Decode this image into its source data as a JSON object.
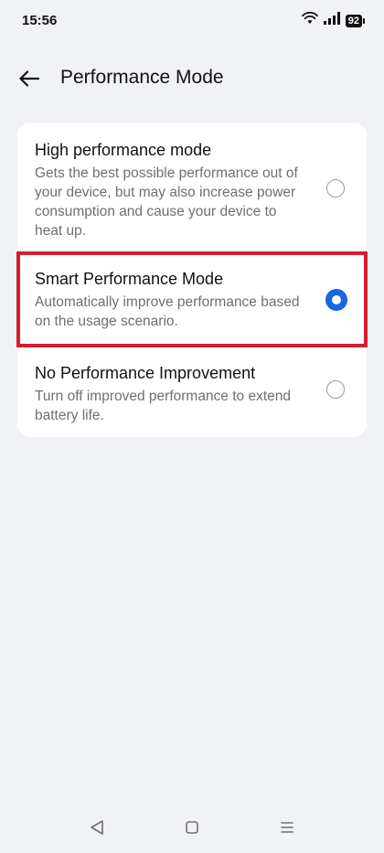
{
  "status_bar": {
    "time": "15:56",
    "battery_level": "92",
    "icons": [
      "wifi-icon",
      "signal-icon",
      "battery-icon"
    ]
  },
  "header": {
    "title": "Performance Mode",
    "back_icon": "arrow-left-icon"
  },
  "options": [
    {
      "title": "High performance mode",
      "description": "Gets the best possible performance out of your device, but may also increase power consumption and cause your device to heat up.",
      "selected": false
    },
    {
      "title": "Smart Performance Mode",
      "description": "Automatically improve performance based on the usage scenario.",
      "selected": true
    },
    {
      "title": "No Performance Improvement",
      "description": "Turn off improved performance to extend battery life.",
      "selected": false
    }
  ],
  "nav_bar": {
    "icons": [
      "back-triangle-icon",
      "home-square-icon",
      "recents-menu-icon"
    ]
  },
  "colors": {
    "background": "#f1f2f5",
    "card": "#ffffff",
    "accent": "#1766e3",
    "highlight": "#d61e2b"
  }
}
